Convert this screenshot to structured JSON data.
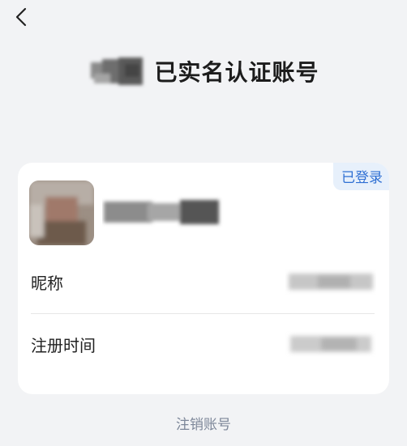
{
  "header": {
    "back_icon": "chevron-left-icon",
    "title": "已实名认证账号"
  },
  "card": {
    "status_badge": "已登录",
    "rows": [
      {
        "label": "昵称"
      },
      {
        "label": "注册时间"
      }
    ]
  },
  "footer": {
    "cancel_label": "注销账号"
  },
  "colors": {
    "background": "#f2f3f5",
    "card": "#ffffff",
    "badge_bg": "#e7f0fb",
    "badge_text": "#2e6fd3",
    "link": "#7d8799"
  }
}
